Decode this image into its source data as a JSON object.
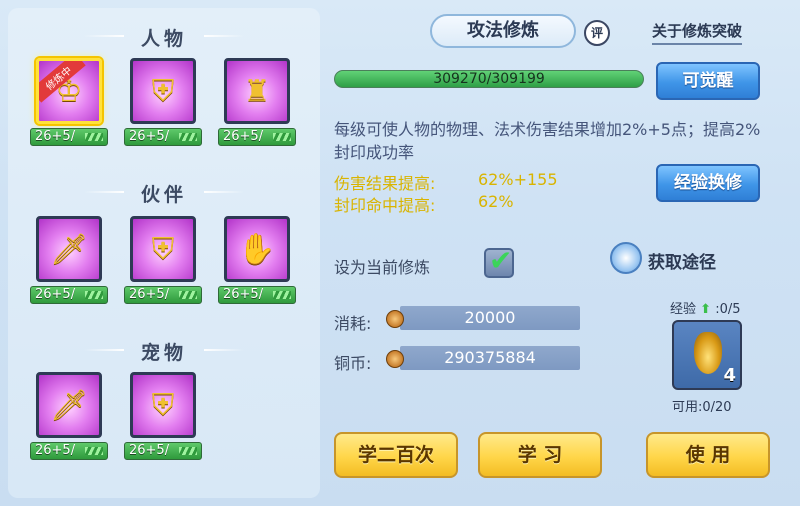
{
  "left": {
    "sections": [
      {
        "title": "人物",
        "skills": [
          {
            "label": "26+5/",
            "training": "修炼中",
            "icon": "warrior-hand-icon"
          },
          {
            "label": "26+5/",
            "icon": "armor-shield-icon"
          },
          {
            "label": "26+5/",
            "icon": "warrior-seal-icon"
          }
        ]
      },
      {
        "title": "伙伴",
        "skills": [
          {
            "label": "26+5/",
            "icon": "lion-sword-icon"
          },
          {
            "label": "26+5/",
            "icon": "lion-shield-icon"
          },
          {
            "label": "26+5/",
            "icon": "lion-claw-icon"
          }
        ]
      },
      {
        "title": "宠物",
        "skills": [
          {
            "label": "26+5/",
            "icon": "cat-sword-icon"
          },
          {
            "label": "26+5/",
            "icon": "cat-shield-icon"
          }
        ]
      }
    ]
  },
  "right": {
    "title": "攻法修炼",
    "review_badge": "评",
    "about_link": "关于修炼突破",
    "exp_text": "309270/309199",
    "awaken_button": "可觉醒",
    "description": "每级可使人物的物理、法术伤害结果增加2%+5点；提高2%封印成功率",
    "stats": [
      {
        "label": "伤害结果提高:",
        "value": "62%+155"
      },
      {
        "label": "封印命中提高:",
        "value": "62%"
      }
    ],
    "exchange_button": "经验换修",
    "set_current_label": "设为当前修炼",
    "acquire_label": "获取途径",
    "cost_label": "消耗:",
    "cost_value": "20000",
    "coins_label": "铜币:",
    "coins_value": "290375884",
    "exp_label": "经验",
    "exp_value": ":0/5",
    "item_count": "4",
    "usable_text": "可用:0/20",
    "buttons": {
      "learn_200": "学二百次",
      "learn": "学 习",
      "use": "使 用"
    }
  }
}
